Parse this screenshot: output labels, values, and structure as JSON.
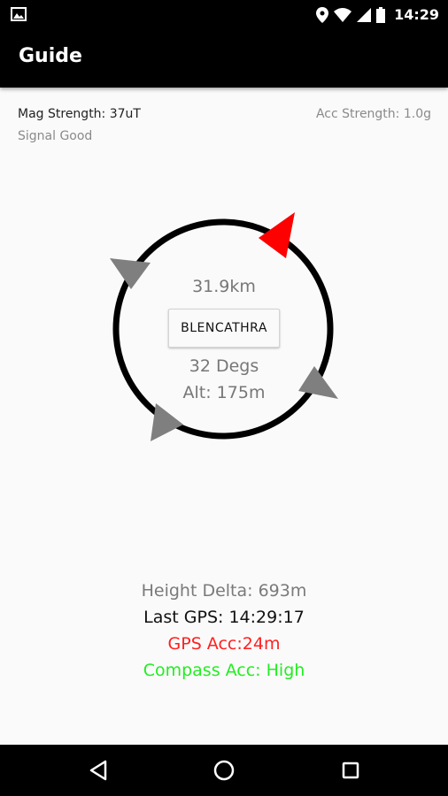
{
  "status_bar": {
    "time": "14:29",
    "icons": [
      "gallery-icon",
      "location-pin-icon",
      "wifi-icon",
      "cell-signal-icon",
      "battery-icon"
    ]
  },
  "app_bar": {
    "title": "Guide"
  },
  "sensors": {
    "mag_strength": "Mag Strength: 37uT",
    "signal": "Signal Good",
    "acc_strength": "Acc Strength: 1.0g"
  },
  "compass": {
    "distance": "31.9km",
    "target_label": "BLENCATHRA",
    "bearing": "32 Degs",
    "altitude": "Alt: 175m",
    "target_marker_color": "#ff0000",
    "marker_color": "#7f7f7f",
    "ring_color": "#000000"
  },
  "info": {
    "height_delta": "Height Delta: 693m",
    "last_gps": "Last GPS: 14:29:17",
    "gps_acc": "GPS Acc:24m",
    "compass_acc": "Compass Acc: High",
    "gps_acc_color": "#ff2020",
    "compass_acc_color": "#22ee22"
  },
  "nav_bar": {
    "icons": [
      "back-icon",
      "home-icon",
      "recents-icon"
    ]
  }
}
